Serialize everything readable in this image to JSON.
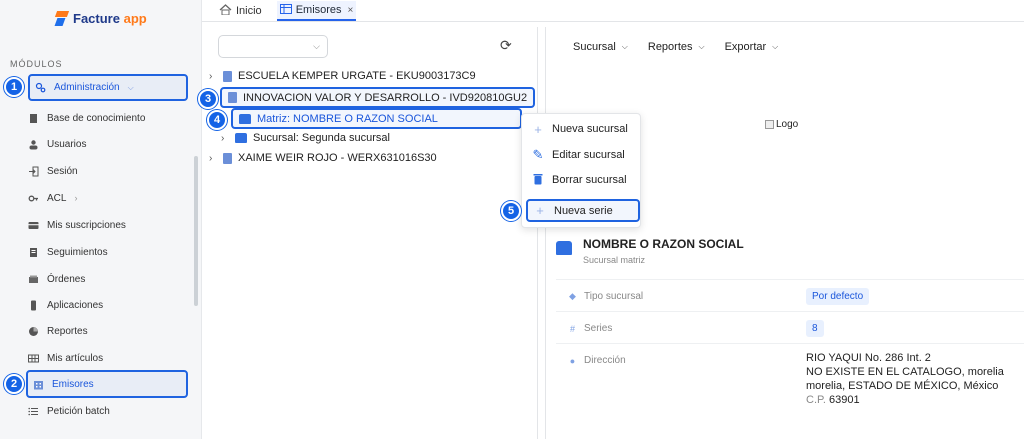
{
  "sidebar": {
    "logo_text": "Facture",
    "logo_accent": "app",
    "section_label": "MÓDULOS",
    "items": [
      {
        "label": "Administración",
        "icon": "gears-icon"
      },
      {
        "label": "Base de conocimiento",
        "icon": "book-icon"
      },
      {
        "label": "Usuarios",
        "icon": "users-icon"
      },
      {
        "label": "Sesión",
        "icon": "login-icon"
      },
      {
        "label": "ACL",
        "icon": "key-icon"
      },
      {
        "label": "Mis suscripciones",
        "icon": "card-icon"
      },
      {
        "label": "Seguimientos",
        "icon": "tracking-icon"
      },
      {
        "label": "Órdenes",
        "icon": "orders-icon"
      },
      {
        "label": "Aplicaciones",
        "icon": "mobile-icon"
      },
      {
        "label": "Reportes",
        "icon": "pie-chart-icon"
      },
      {
        "label": "Mis artículos",
        "icon": "grid-icon"
      },
      {
        "label": "Emisores",
        "icon": "building-icon"
      },
      {
        "label": "Petición batch",
        "icon": "list-icon"
      }
    ]
  },
  "tabs": [
    {
      "label": "Inicio",
      "icon": "home-icon"
    },
    {
      "label": "Emisores",
      "icon": "table-icon",
      "close": "×"
    }
  ],
  "tree": {
    "rows": [
      {
        "label": "ESCUELA KEMPER URGATE - EKU9003173C9"
      },
      {
        "label": "INNOVACION VALOR Y DESARROLLO - IVD920810GU2"
      },
      {
        "label": "Matriz: NOMBRE O RAZON SOCIAL"
      },
      {
        "label": "Sucursal: Segunda sucursal"
      },
      {
        "label": "XAIME WEIR ROJO - WERX631016S30"
      }
    ]
  },
  "context_menu": {
    "items": [
      {
        "label": "Nueva sucursal",
        "icon": "plus-icon"
      },
      {
        "label": "Editar sucursal",
        "icon": "edit-icon"
      },
      {
        "label": "Borrar sucursal",
        "icon": "trash-icon"
      },
      {
        "label": "Nueva serie",
        "icon": "plus-icon"
      }
    ]
  },
  "detail": {
    "toolbar": [
      "Sucursal",
      "Reportes",
      "Exportar"
    ],
    "logo_alt": "Logo",
    "name": "NOMBRE O RAZON SOCIAL",
    "subtitle": "Sucursal matriz",
    "fields": {
      "tipo_label": "Tipo sucursal",
      "tipo_value": "Por defecto",
      "series_label": "Series",
      "series_value": "8",
      "direccion_label": "Dirección",
      "address_line1": "RIO YAQUI No. 286 Int. 2",
      "address_line2": "NO EXISTE EN EL CATALOGO, morelia",
      "address_line3": "morelia, ESTADO DE MÉXICO, México",
      "cp_label": "C.P.",
      "cp_value": "63901"
    }
  },
  "badges": [
    "1",
    "2",
    "3",
    "4",
    "5"
  ],
  "colors": {
    "accent": "#1f63e0",
    "brand_orange": "#ff7a1a",
    "pill_bg": "#e8f0fe"
  }
}
